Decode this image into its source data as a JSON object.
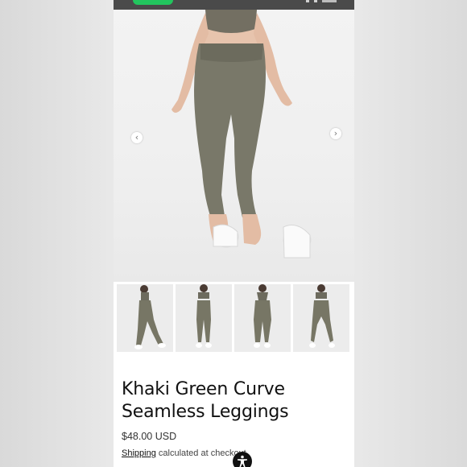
{
  "status_bar": {
    "accent_color": "#22c55e"
  },
  "hero": {
    "prev_arrow": "‹",
    "next_arrow": "›"
  },
  "thumbnails": [
    {
      "pose": "side"
    },
    {
      "pose": "front"
    },
    {
      "pose": "back"
    },
    {
      "pose": "front-alt"
    }
  ],
  "product": {
    "title_line1": "Khaki Green Curve",
    "title_line2": "Seamless Leggings",
    "price": "$48.00 USD",
    "shipping_link": "Shipping",
    "shipping_rest": " calculated at checkout."
  },
  "accessibility_button": {
    "icon": "accessibility-icon"
  }
}
